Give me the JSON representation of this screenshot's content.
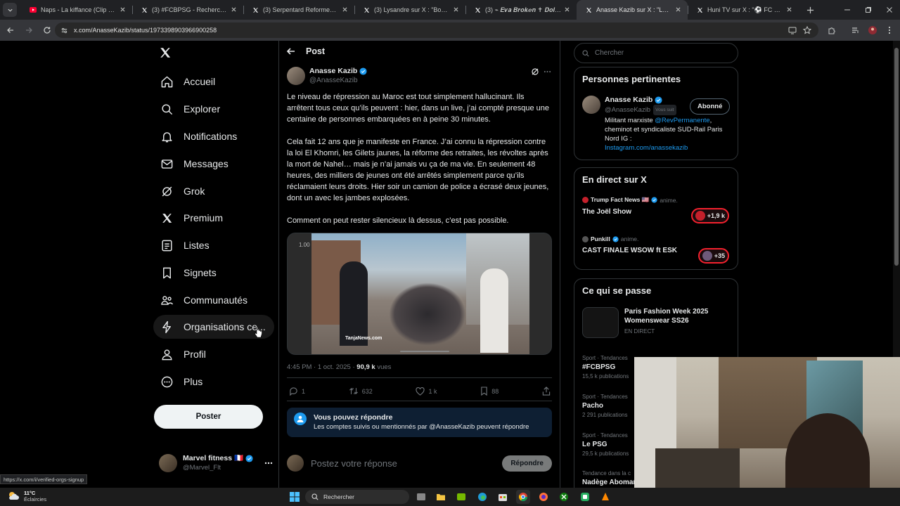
{
  "browser": {
    "tabs": [
      {
        "title": "Naps - La kiffance (Clip Officiel)",
        "icon": "youtube-icon",
        "color": "#ff0033"
      },
      {
        "title": "(3) #FCBPSG - Recherche / X",
        "icon": "x-icon",
        "color": "#e7e9ea"
      },
      {
        "title": "(3) Serpentard Reformed 🐍 (@",
        "icon": "x-icon",
        "color": "#e7e9ea"
      },
      {
        "title": "(3) Lysandre sur X : \"Bonjour M",
        "icon": "x-icon",
        "color": "#e7e9ea"
      },
      {
        "title": "(3) ⌁ 𝑬𝒗𝒂 𝑩𝒓𝒐𝒌𝒆𝒏 ✝ 𝑫𝒐𝒍𝒍 ⌁ sur",
        "icon": "x-icon",
        "color": "#e7e9ea"
      },
      {
        "title": "Anasse Kazib sur X : \"Le niveau",
        "icon": "x-icon",
        "color": "#e7e9ea",
        "active": true
      },
      {
        "title": "Huni TV sur X : \"⚽ FC BARCEL",
        "icon": "x-icon",
        "color": "#e7e9ea"
      }
    ],
    "url": "x.com/AnasseKazib/status/1973398903966900258",
    "status_url": "https://x.com/i/verified-orgs-signup"
  },
  "nav": {
    "items": [
      {
        "label": "Accueil",
        "icon": "home-icon"
      },
      {
        "label": "Explorer",
        "icon": "search-icon"
      },
      {
        "label": "Notifications",
        "icon": "bell-icon"
      },
      {
        "label": "Messages",
        "icon": "mail-icon"
      },
      {
        "label": "Grok",
        "icon": "grok-icon"
      },
      {
        "label": "Premium",
        "icon": "x-logo-icon"
      },
      {
        "label": "Listes",
        "icon": "list-icon"
      },
      {
        "label": "Signets",
        "icon": "bookmark-icon"
      },
      {
        "label": "Communautés",
        "icon": "communities-icon"
      },
      {
        "label": "Organisations ce...",
        "icon": "lightning-icon"
      },
      {
        "label": "Profil",
        "icon": "person-icon"
      },
      {
        "label": "Plus",
        "icon": "more-circle-icon"
      }
    ],
    "post_button": "Poster",
    "account": {
      "name": "Marvel fitness 🇫🇷",
      "handle": "@Marvel_Flt"
    }
  },
  "post": {
    "header": "Post",
    "author": "Anasse Kazib",
    "handle": "@AnasseKazib",
    "paragraphs": [
      "Le niveau de répression au Maroc est tout simplement hallucinant. Ils arrêtent tous ceux qu’ils peuvent : hier, dans un live, j’ai compté presque une centaine de personnes embarquées en à peine 30 minutes.",
      "Cela fait 12 ans que je manifeste en France. J’ai connu la répression contre la loi El Khomri, les Gilets jaunes, la réforme des retraites, les révoltes après la mort de Nahel… mais je n’ai jamais vu ça de ma vie. En seulement 48 heures, des milliers de jeunes ont été arrêtés simplement parce qu’ils réclamaient leurs droits. Hier soir un camion de police a écrasé deux jeunes, dont un avec les jambes explosées.",
      "Comment on peut rester silencieux là dessus, c’est pas possible."
    ],
    "video_speed": "1.00",
    "video_watermark": "TanjaNews.com",
    "timestamp": "4:45 PM · 1 oct. 2025 · ",
    "views": "90,9 k",
    "views_label": " vues",
    "stats": {
      "replies": "1",
      "reposts": "632",
      "likes": "1 k",
      "bookmarks": "88"
    },
    "reply_notice": {
      "title": "Vous pouvez répondre",
      "text": "Les comptes suivis ou mentionnés par @AnasseKazib peuvent répondre"
    },
    "reply_placeholder": "Postez votre réponse",
    "reply_button": "Répondre"
  },
  "sidebar": {
    "search_placeholder": "Chercher",
    "relevant": {
      "title": "Personnes pertinentes",
      "name": "Anasse Kazib",
      "handle": "@AnasseKazib",
      "follows_you": "Vous suit",
      "button": "Abonné",
      "bio_prefix": "Militant marxiste ",
      "bio_mention": "@RevPermanente",
      "bio_rest": ", cheminot et syndicaliste SUD-Rail Paris Nord IG :",
      "bio_link": "Instagram.com/anassekazib"
    },
    "live": {
      "title": "En direct sur X",
      "items": [
        {
          "host": "Trump Fact News 🇺🇸",
          "action": "anime.",
          "show": "The Joël Show",
          "count": "+1,9 k"
        },
        {
          "host": "Punkill",
          "action": "anime.",
          "show": "CAST FINALE WSOW ft ESK",
          "count": "+35"
        }
      ]
    },
    "happening": {
      "title": "Ce qui se passe",
      "featured": {
        "title": "Paris Fashion Week 2025 Womenswear SS26",
        "status": "EN DIRECT"
      },
      "trends": [
        {
          "category": "Sport · Tendances",
          "name": "#FCBPSG",
          "count": "15,5 k publications"
        },
        {
          "category": "Sport · Tendances",
          "name": "Pacho",
          "count": "2 291 publications"
        },
        {
          "category": "Sport · Tendances",
          "name": "Le PSG",
          "count": "29,5 k publications"
        },
        {
          "category": "Tendance dans la c",
          "name": "Nadège Abomang",
          "count": ""
        }
      ]
    }
  },
  "taskbar": {
    "weather_temp": "11°C",
    "weather_text": "Éclaircies",
    "search_placeholder": "Rechercher"
  }
}
